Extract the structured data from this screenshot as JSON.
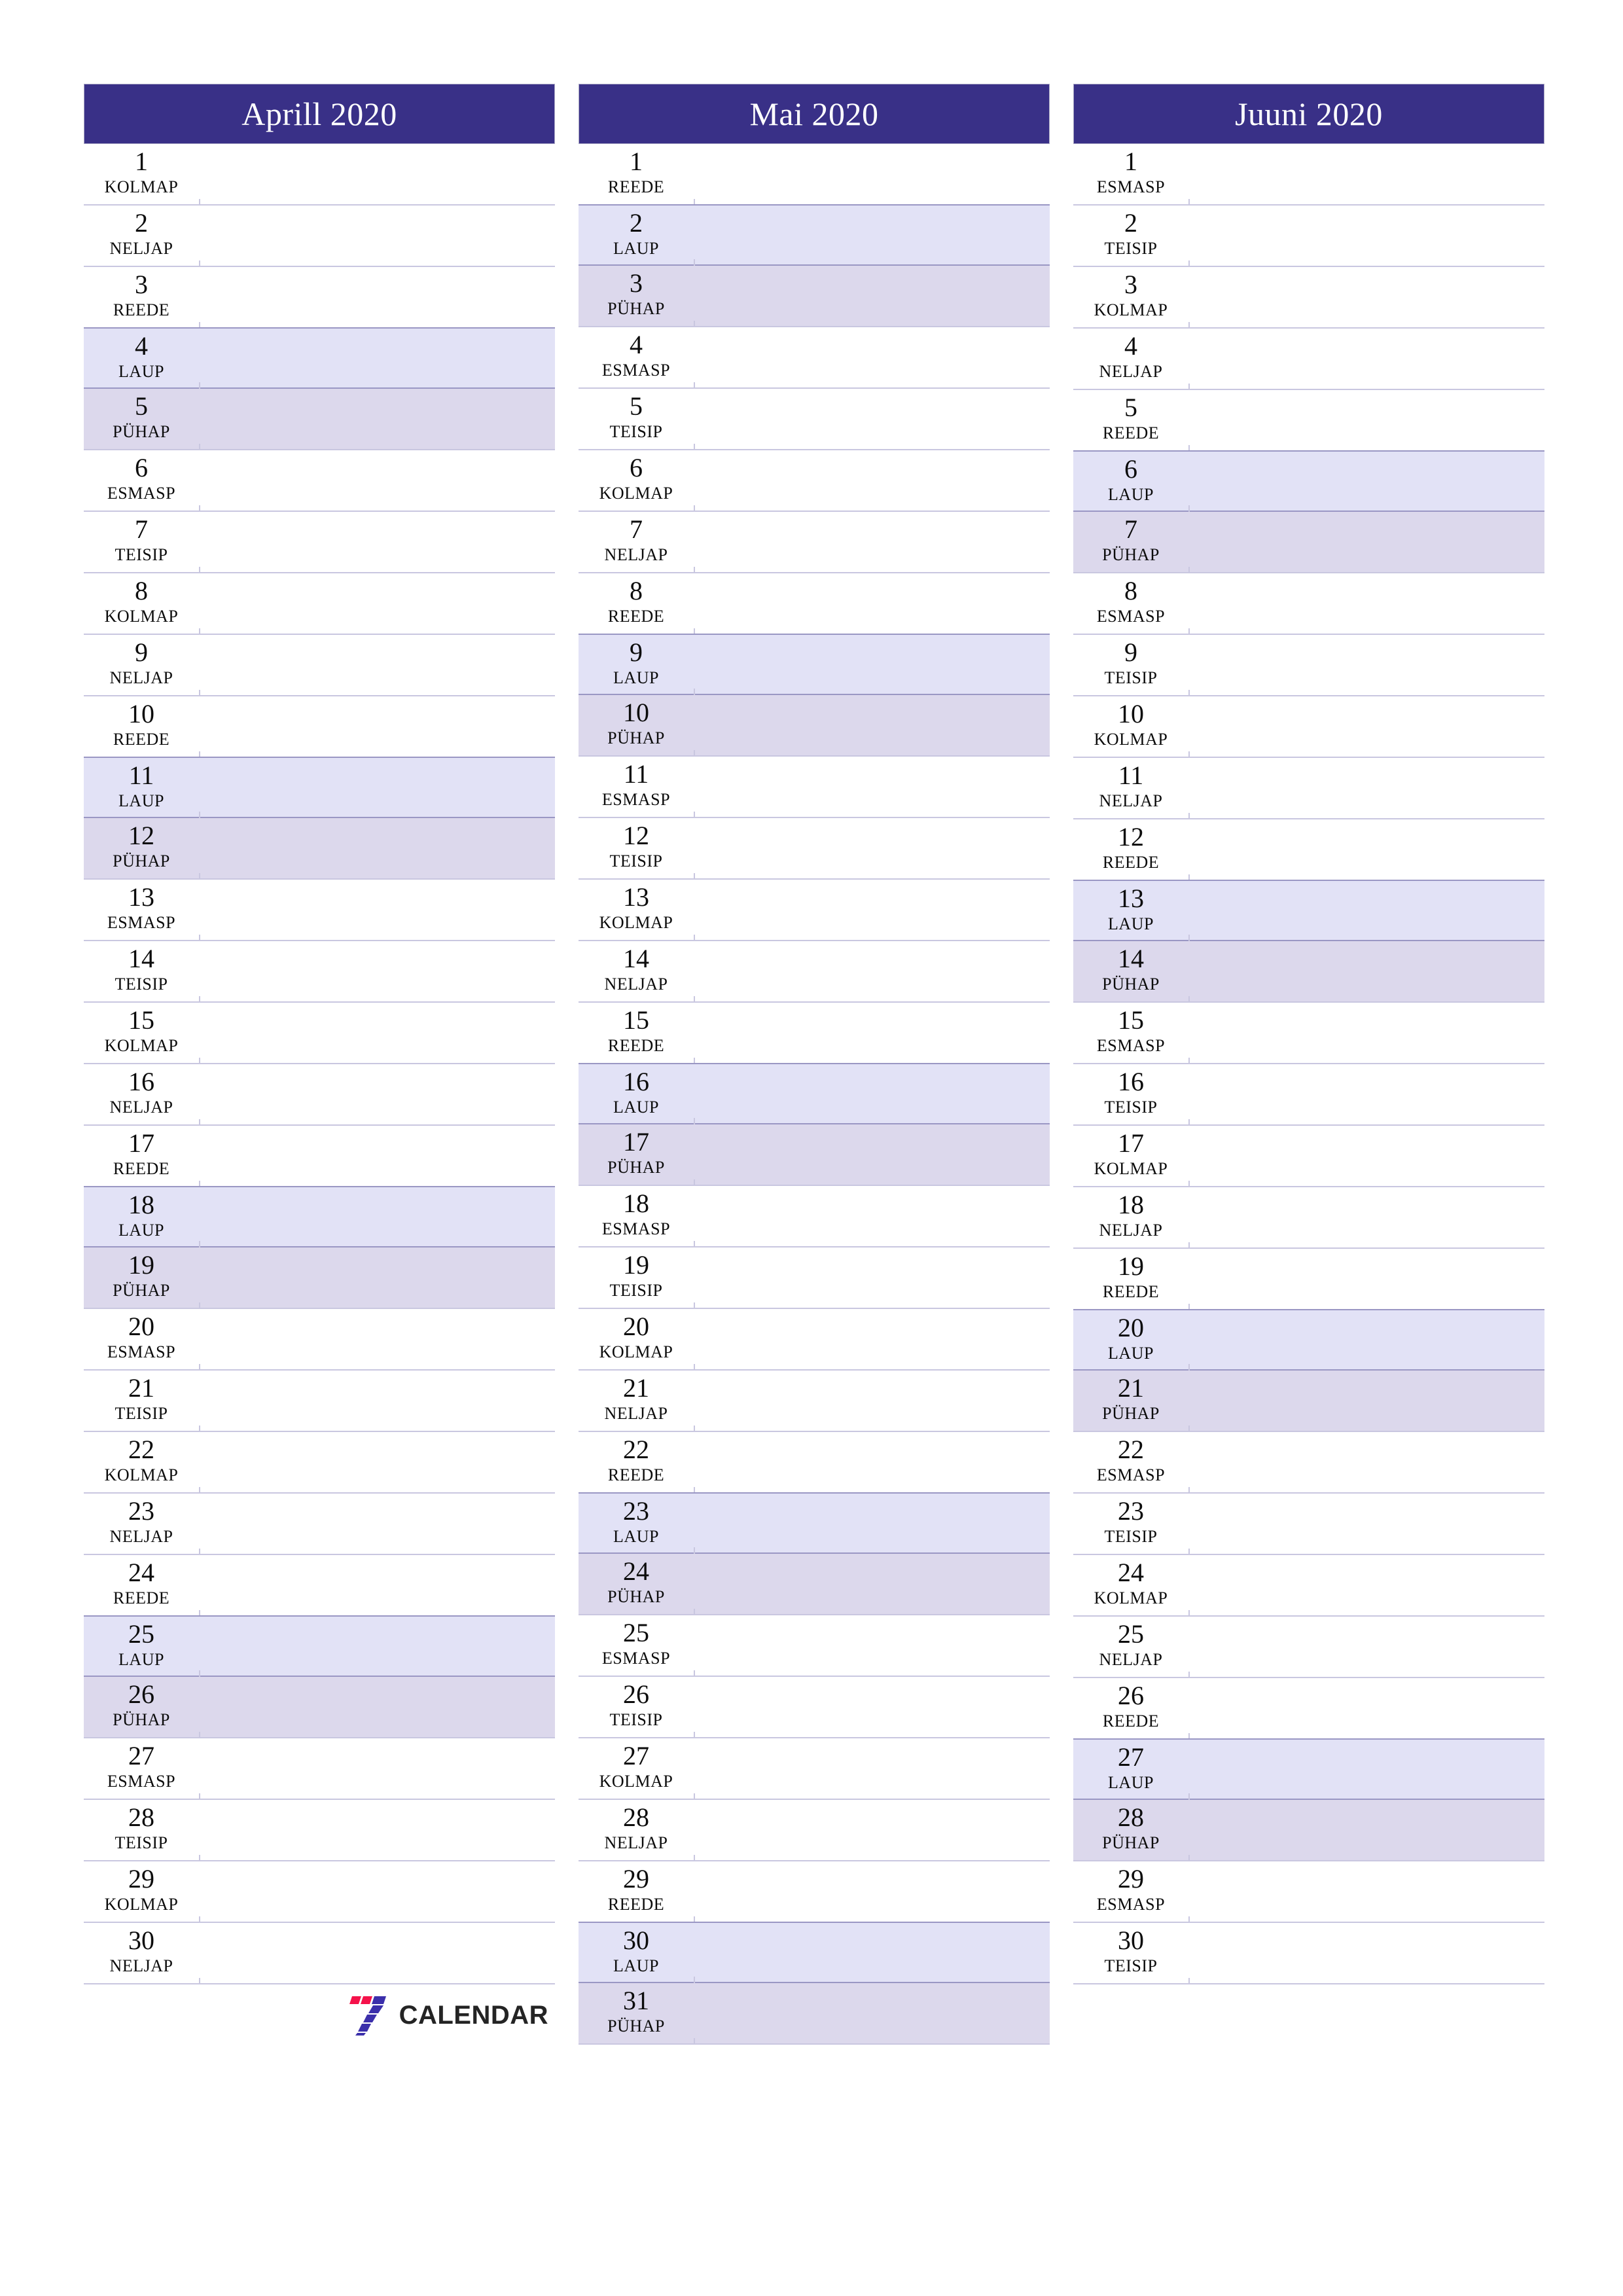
{
  "document": {
    "type": "quarterly-planner",
    "locale": "et",
    "orientation": "portrait"
  },
  "colors": {
    "header_bg": "#393087",
    "header_text": "#ffffff",
    "saturday_bg": "#e2e2f6",
    "sunday_bg": "#dcd8ec",
    "rule": "#c9c7e0",
    "text": "#0c0c0c",
    "logo_red": "#f5124a",
    "logo_blue": "#3b2fab",
    "logo_word": "#242424"
  },
  "weekday_labels": {
    "mon": "ESMASP",
    "tue": "TEISIP",
    "wed": "KOLMAP",
    "thu": "NELJAP",
    "fri": "REEDE",
    "sat": "LAUP",
    "sun": "PÜHAP"
  },
  "logo": {
    "mark": "seven-mark-icon",
    "word": "CALENDAR"
  },
  "months": [
    {
      "title": "Aprill 2020",
      "days": [
        {
          "n": "1",
          "w": "KOLMAP",
          "t": "wd"
        },
        {
          "n": "2",
          "w": "NELJAP",
          "t": "wd"
        },
        {
          "n": "3",
          "w": "REEDE",
          "t": "wd"
        },
        {
          "n": "4",
          "w": "LAUP",
          "t": "sat"
        },
        {
          "n": "5",
          "w": "PÜHAP",
          "t": "sun"
        },
        {
          "n": "6",
          "w": "ESMASP",
          "t": "wd"
        },
        {
          "n": "7",
          "w": "TEISIP",
          "t": "wd"
        },
        {
          "n": "8",
          "w": "KOLMAP",
          "t": "wd"
        },
        {
          "n": "9",
          "w": "NELJAP",
          "t": "wd"
        },
        {
          "n": "10",
          "w": "REEDE",
          "t": "wd"
        },
        {
          "n": "11",
          "w": "LAUP",
          "t": "sat"
        },
        {
          "n": "12",
          "w": "PÜHAP",
          "t": "sun"
        },
        {
          "n": "13",
          "w": "ESMASP",
          "t": "wd"
        },
        {
          "n": "14",
          "w": "TEISIP",
          "t": "wd"
        },
        {
          "n": "15",
          "w": "KOLMAP",
          "t": "wd"
        },
        {
          "n": "16",
          "w": "NELJAP",
          "t": "wd"
        },
        {
          "n": "17",
          "w": "REEDE",
          "t": "wd"
        },
        {
          "n": "18",
          "w": "LAUP",
          "t": "sat"
        },
        {
          "n": "19",
          "w": "PÜHAP",
          "t": "sun"
        },
        {
          "n": "20",
          "w": "ESMASP",
          "t": "wd"
        },
        {
          "n": "21",
          "w": "TEISIP",
          "t": "wd"
        },
        {
          "n": "22",
          "w": "KOLMAP",
          "t": "wd"
        },
        {
          "n": "23",
          "w": "NELJAP",
          "t": "wd"
        },
        {
          "n": "24",
          "w": "REEDE",
          "t": "wd"
        },
        {
          "n": "25",
          "w": "LAUP",
          "t": "sat"
        },
        {
          "n": "26",
          "w": "PÜHAP",
          "t": "sun"
        },
        {
          "n": "27",
          "w": "ESMASP",
          "t": "wd"
        },
        {
          "n": "28",
          "w": "TEISIP",
          "t": "wd"
        },
        {
          "n": "29",
          "w": "KOLMAP",
          "t": "wd"
        },
        {
          "n": "30",
          "w": "NELJAP",
          "t": "wd"
        }
      ],
      "has_logo": true
    },
    {
      "title": "Mai 2020",
      "days": [
        {
          "n": "1",
          "w": "REEDE",
          "t": "wd"
        },
        {
          "n": "2",
          "w": "LAUP",
          "t": "sat"
        },
        {
          "n": "3",
          "w": "PÜHAP",
          "t": "sun"
        },
        {
          "n": "4",
          "w": "ESMASP",
          "t": "wd"
        },
        {
          "n": "5",
          "w": "TEISIP",
          "t": "wd"
        },
        {
          "n": "6",
          "w": "KOLMAP",
          "t": "wd"
        },
        {
          "n": "7",
          "w": "NELJAP",
          "t": "wd"
        },
        {
          "n": "8",
          "w": "REEDE",
          "t": "wd"
        },
        {
          "n": "9",
          "w": "LAUP",
          "t": "sat"
        },
        {
          "n": "10",
          "w": "PÜHAP",
          "t": "sun"
        },
        {
          "n": "11",
          "w": "ESMASP",
          "t": "wd"
        },
        {
          "n": "12",
          "w": "TEISIP",
          "t": "wd"
        },
        {
          "n": "13",
          "w": "KOLMAP",
          "t": "wd"
        },
        {
          "n": "14",
          "w": "NELJAP",
          "t": "wd"
        },
        {
          "n": "15",
          "w": "REEDE",
          "t": "wd"
        },
        {
          "n": "16",
          "w": "LAUP",
          "t": "sat"
        },
        {
          "n": "17",
          "w": "PÜHAP",
          "t": "sun"
        },
        {
          "n": "18",
          "w": "ESMASP",
          "t": "wd"
        },
        {
          "n": "19",
          "w": "TEISIP",
          "t": "wd"
        },
        {
          "n": "20",
          "w": "KOLMAP",
          "t": "wd"
        },
        {
          "n": "21",
          "w": "NELJAP",
          "t": "wd"
        },
        {
          "n": "22",
          "w": "REEDE",
          "t": "wd"
        },
        {
          "n": "23",
          "w": "LAUP",
          "t": "sat"
        },
        {
          "n": "24",
          "w": "PÜHAP",
          "t": "sun"
        },
        {
          "n": "25",
          "w": "ESMASP",
          "t": "wd"
        },
        {
          "n": "26",
          "w": "TEISIP",
          "t": "wd"
        },
        {
          "n": "27",
          "w": "KOLMAP",
          "t": "wd"
        },
        {
          "n": "28",
          "w": "NELJAP",
          "t": "wd"
        },
        {
          "n": "29",
          "w": "REEDE",
          "t": "wd"
        },
        {
          "n": "30",
          "w": "LAUP",
          "t": "sat"
        },
        {
          "n": "31",
          "w": "PÜHAP",
          "t": "sun"
        }
      ],
      "has_logo": false
    },
    {
      "title": "Juuni 2020",
      "days": [
        {
          "n": "1",
          "w": "ESMASP",
          "t": "wd"
        },
        {
          "n": "2",
          "w": "TEISIP",
          "t": "wd"
        },
        {
          "n": "3",
          "w": "KOLMAP",
          "t": "wd"
        },
        {
          "n": "4",
          "w": "NELJAP",
          "t": "wd"
        },
        {
          "n": "5",
          "w": "REEDE",
          "t": "wd"
        },
        {
          "n": "6",
          "w": "LAUP",
          "t": "sat"
        },
        {
          "n": "7",
          "w": "PÜHAP",
          "t": "sun"
        },
        {
          "n": "8",
          "w": "ESMASP",
          "t": "wd"
        },
        {
          "n": "9",
          "w": "TEISIP",
          "t": "wd"
        },
        {
          "n": "10",
          "w": "KOLMAP",
          "t": "wd"
        },
        {
          "n": "11",
          "w": "NELJAP",
          "t": "wd"
        },
        {
          "n": "12",
          "w": "REEDE",
          "t": "wd"
        },
        {
          "n": "13",
          "w": "LAUP",
          "t": "sat"
        },
        {
          "n": "14",
          "w": "PÜHAP",
          "t": "sun"
        },
        {
          "n": "15",
          "w": "ESMASP",
          "t": "wd"
        },
        {
          "n": "16",
          "w": "TEISIP",
          "t": "wd"
        },
        {
          "n": "17",
          "w": "KOLMAP",
          "t": "wd"
        },
        {
          "n": "18",
          "w": "NELJAP",
          "t": "wd"
        },
        {
          "n": "19",
          "w": "REEDE",
          "t": "wd"
        },
        {
          "n": "20",
          "w": "LAUP",
          "t": "sat"
        },
        {
          "n": "21",
          "w": "PÜHAP",
          "t": "sun"
        },
        {
          "n": "22",
          "w": "ESMASP",
          "t": "wd"
        },
        {
          "n": "23",
          "w": "TEISIP",
          "t": "wd"
        },
        {
          "n": "24",
          "w": "KOLMAP",
          "t": "wd"
        },
        {
          "n": "25",
          "w": "NELJAP",
          "t": "wd"
        },
        {
          "n": "26",
          "w": "REEDE",
          "t": "wd"
        },
        {
          "n": "27",
          "w": "LAUP",
          "t": "sat"
        },
        {
          "n": "28",
          "w": "PÜHAP",
          "t": "sun"
        },
        {
          "n": "29",
          "w": "ESMASP",
          "t": "wd"
        },
        {
          "n": "30",
          "w": "TEISIP",
          "t": "wd"
        }
      ],
      "has_logo": false
    }
  ]
}
